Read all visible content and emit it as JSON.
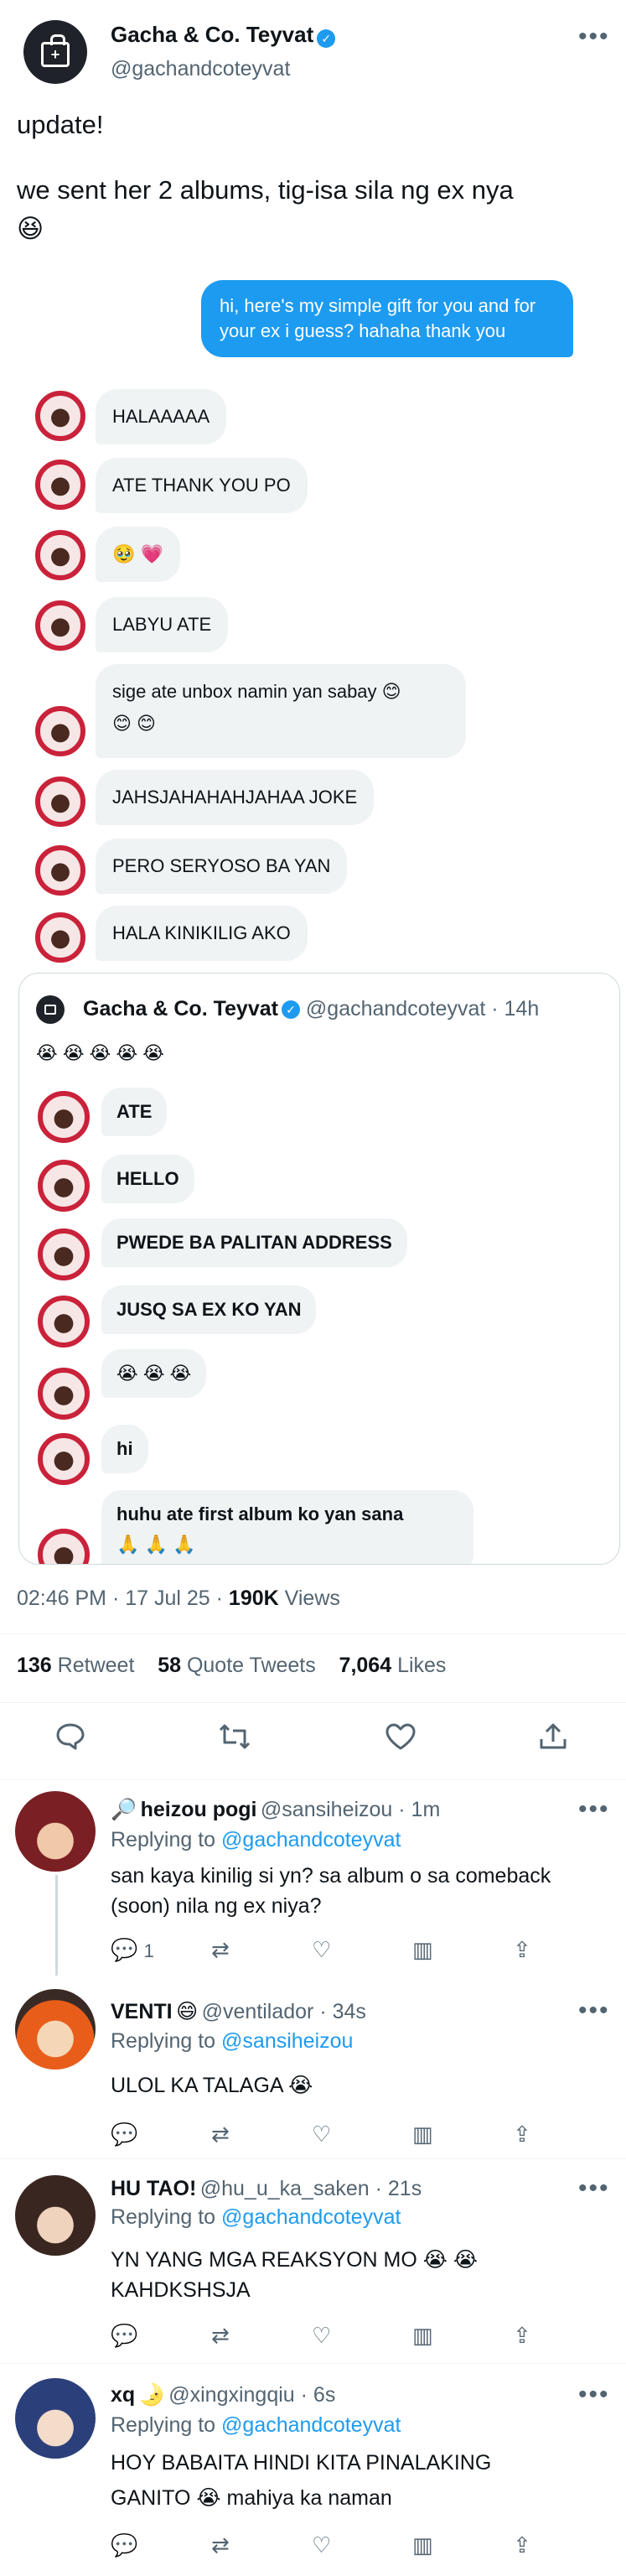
{
  "tweet": {
    "name": "Gacha & Co. Teyvat",
    "handle": "@gachandcoteyvat",
    "text_line1": "update!",
    "text_line2": "we sent her 2 albums, tig-isa sila ng ex nya",
    "text_line3": "😆"
  },
  "chat": {
    "sent": "hi, here's my simple gift for you and for your ex i guess? hahaha thank you",
    "received": [
      "HALAAAAA",
      "ATE THANK YOU PO",
      "🥹 💗",
      "LABYU ATE",
      "sige ate unbox namin yan sabay 😊",
      "😊 😊",
      "JAHSJAHAHAHJAHAA JOKE",
      "PERO SERYOSO BA YAN",
      "HALA KINIKILIG AKO"
    ]
  },
  "quote": {
    "name": "Gacha & Co. Teyvat",
    "handle": "@gachandcoteyvat",
    "time": "· 14h",
    "emojis": "😭 😭 😭 😭 😭",
    "messages": [
      "ATE",
      "HELLO",
      "PWEDE BA PALITAN ADDRESS",
      "JUSQ SA EX KO YAN",
      "😭 😭 😭",
      "hi",
      "huhu ate first album ko yan sana",
      "🙏 🙏 🙏"
    ]
  },
  "meta": {
    "time": "02:46 PM · 17 Jul 25 ·",
    "views_count": "190K",
    "views_label": "Views",
    "retweets": "136",
    "retweets_label": "Retweet",
    "quotes": "58",
    "quotes_label": "Quote Tweets",
    "likes": "7,064",
    "likes_label": "Likes"
  },
  "replies": [
    {
      "name": "heizou pogi",
      "prefix": "🔎",
      "handle": "@sansiheizou · 1m",
      "replying": "Replying to",
      "to": "@gachandcoteyvat",
      "text1": "san kaya kinilig si yn? sa album o sa comeback",
      "text2": "(soon) nila ng ex niya?",
      "reply_count": "1"
    },
    {
      "name": "VENTI",
      "suffix": "😄",
      "handle": "@ventilador · 34s",
      "replying": "Replying to",
      "to": "@sansiheizou",
      "text1": "ULOL KA TALAGA 😭",
      "text2": ""
    },
    {
      "name": "HU TAO!",
      "handle": "@hu_u_ka_saken · 21s",
      "replying": "Replying to",
      "to": "@gachandcoteyvat",
      "text1": "YN YANG MGA REAKSYON MO 😭 😭",
      "text2": "KAHDKSHSJA"
    },
    {
      "name": "xq",
      "suffix": "🌛",
      "handle": "@xingxingqiu · 6s",
      "replying": "Replying to",
      "to": "@gachandcoteyvat",
      "text1": "HOY BABAITA HINDI KITA PINALAKING",
      "text2": "GANITO 😭  mahiya ka naman"
    }
  ],
  "colors": {
    "accent": "#1d9bf0",
    "bubble": "#eff3f4",
    "heart": "#c9223a"
  },
  "icons": [
    "verified-icon",
    "more-icon",
    "reply-icon",
    "retweet-icon",
    "like-icon",
    "share-icon",
    "analytics-icon"
  ]
}
